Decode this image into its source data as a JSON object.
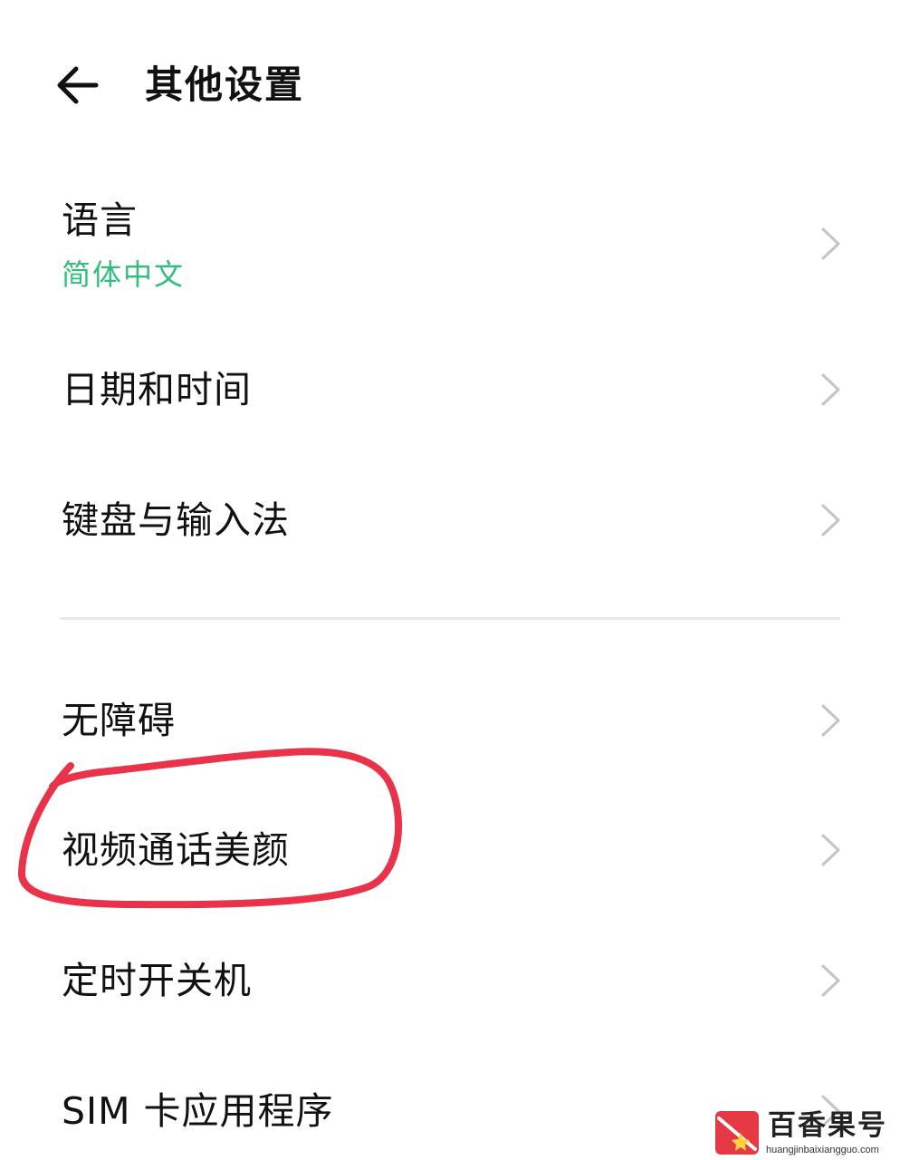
{
  "header": {
    "title": "其他设置",
    "back_icon": "back-arrow-icon"
  },
  "settings": {
    "language": {
      "label": "语言",
      "value": "简体中文"
    },
    "date_time": {
      "label": "日期和时间"
    },
    "keyboard": {
      "label": "键盘与输入法"
    },
    "accessibility": {
      "label": "无障碍"
    },
    "video_call_beauty": {
      "label": "视频通话美颜"
    },
    "scheduled_power": {
      "label": "定时开关机"
    },
    "sim_apps": {
      "label": "SIM 卡应用程序"
    }
  },
  "icons": {
    "row_chevron": "chevron-right-icon"
  },
  "colors": {
    "accent": "#2fbf7a",
    "annotation": "#e8334a",
    "chevron": "#c4c4c4",
    "divider": "#e8e8e8"
  },
  "watermark": {
    "brand": "百香果号",
    "url": "huangjinbaixiangguo.com"
  }
}
